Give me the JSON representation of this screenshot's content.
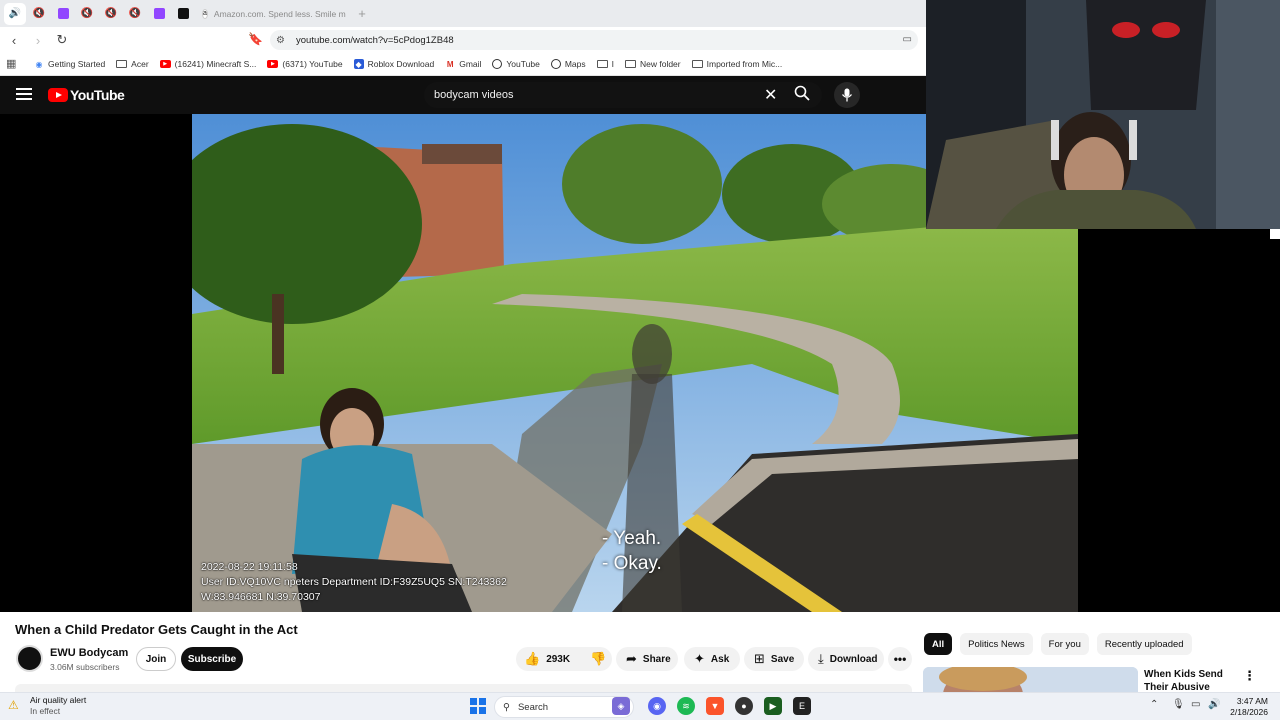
{
  "browser": {
    "tabs": [
      {
        "icon": "speaker-icon",
        "active": true
      },
      {
        "icon": "muted-icon"
      },
      {
        "icon": "twitch-icon"
      },
      {
        "icon": "muted-icon"
      },
      {
        "icon": "muted-icon"
      },
      {
        "icon": "muted-icon"
      },
      {
        "icon": "twitch-icon"
      },
      {
        "icon": "black-app-icon"
      }
    ],
    "current_tab_title": "Amazon.com. Spend less. Smile more.",
    "current_tab_favicon": "a",
    "new_tab_label": "+",
    "url": "youtube.com/watch?v=5cPdog1ZB48"
  },
  "bookmarks": [
    {
      "label": "Getting Started",
      "icon": "getting-started-icon",
      "glyph": "◉"
    },
    {
      "label": "Acer",
      "icon": "folder-icon",
      "glyph": ""
    },
    {
      "label": "(16241) Minecraft S...",
      "icon": "youtube-icon",
      "glyph": "▶"
    },
    {
      "label": "(6371) YouTube",
      "icon": "youtube-icon",
      "glyph": "▶"
    },
    {
      "label": "Roblox Download",
      "icon": "roblox-icon",
      "glyph": "◆"
    },
    {
      "label": "Gmail",
      "icon": "gmail-icon",
      "glyph": "M"
    },
    {
      "label": "YouTube",
      "icon": "globe-icon",
      "glyph": ""
    },
    {
      "label": "Maps",
      "icon": "globe-icon",
      "glyph": ""
    },
    {
      "label": "I",
      "icon": "folder-icon",
      "glyph": ""
    },
    {
      "label": "New folder",
      "icon": "folder-icon",
      "glyph": ""
    },
    {
      "label": "Imported from Mic...",
      "icon": "folder-icon",
      "glyph": ""
    }
  ],
  "youtube": {
    "logo_text": "YouTube",
    "search_query": "bodycam videos",
    "clear_glyph": "✕",
    "search_glyph": "⚲",
    "mic_glyph": "🎙"
  },
  "video": {
    "caption_lines": [
      "- Yeah.",
      "- Okay."
    ],
    "overlay_lines": [
      "2022-08-22 19:11:58",
      "User ID:VQ10VC npeters Department ID:F39Z5UQ5 SN:T243362",
      "W:83.946681 N:39.70307"
    ]
  },
  "details": {
    "title": "When a Child Predator Gets Caught in the Act",
    "channel_name": "EWU Bodycam",
    "subscribers": "3.06M subscribers",
    "join_label": "Join",
    "subscribe_label": "Subscribe",
    "likes": "293K",
    "share_label": "Share",
    "ask_label": "Ask",
    "save_label": "Save",
    "download_label": "Download",
    "more_glyph": "•••"
  },
  "sidebar": {
    "chips": [
      "All",
      "Politics News",
      "For you",
      "Recently uploaded"
    ],
    "rec_title": "When Kids Send Their Abusive Parents to",
    "rec_more": "⋮"
  },
  "taskbar": {
    "weather_title": "Air quality alert",
    "weather_sub": "In effect",
    "search_placeholder": "Search",
    "time": "3:47 AM",
    "date": "2/18/2026"
  },
  "colors": {
    "youtube_red": "#ff0000",
    "yt_header": "#0f0f0f",
    "twitch": "#9146ff",
    "windows_blue": "#1a73e8"
  }
}
